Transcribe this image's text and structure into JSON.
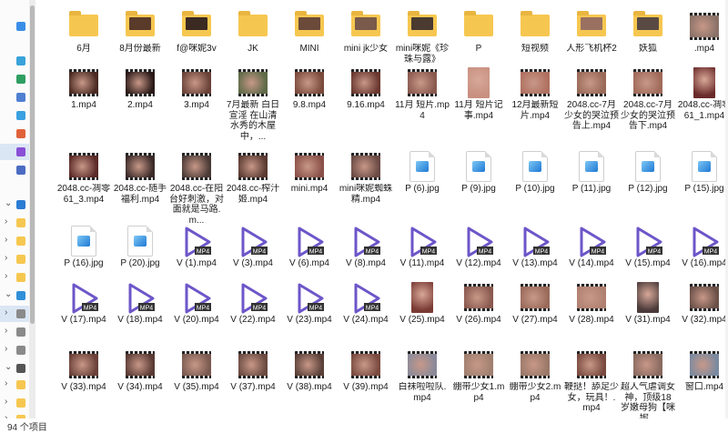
{
  "status": {
    "count": "94 个项目"
  },
  "colors": {
    "folder": "#f6c750",
    "play": "#6d56c9",
    "selection": "#dbe6f4"
  },
  "sidebar": [
    {
      "icon": "cloud-icon",
      "color": "#3a8ee6",
      "selected": false,
      "chevron": ""
    },
    {
      "icon": "desktop-icon",
      "color": "#39a2d8",
      "selected": false,
      "chevron": ""
    },
    {
      "icon": "downloads-icon",
      "color": "#2f9e62",
      "selected": false,
      "chevron": ""
    },
    {
      "icon": "documents-icon",
      "color": "#4f7fd1",
      "selected": false,
      "chevron": ""
    },
    {
      "icon": "pictures-icon",
      "color": "#3aa0e0",
      "selected": false,
      "chevron": ""
    },
    {
      "icon": "music-icon",
      "color": "#e0623a",
      "selected": false,
      "chevron": ""
    },
    {
      "icon": "videos-icon",
      "color": "#8a4fd6",
      "selected": true,
      "chevron": ""
    },
    {
      "icon": "drive-icon",
      "color": "#4b6cc2",
      "selected": false,
      "chevron": ""
    },
    {
      "icon": "onedrive-icon",
      "color": "#2b7cd3",
      "selected": false,
      "chevron": "⌄"
    },
    {
      "icon": "folder-icon",
      "color": "#f6c750",
      "selected": false,
      "chevron": "›"
    },
    {
      "icon": "folder-icon",
      "color": "#f6c750",
      "selected": false,
      "chevron": "›"
    },
    {
      "icon": "folder-icon",
      "color": "#f6c750",
      "selected": false,
      "chevron": "›"
    },
    {
      "icon": "folder-icon",
      "color": "#f6c750",
      "selected": false,
      "chevron": "›"
    },
    {
      "icon": "computer-icon",
      "color": "#2f8fd8",
      "selected": false,
      "chevron": "⌄"
    },
    {
      "icon": "drive-icon",
      "color": "#8a8a8a",
      "selected": true,
      "chevron": "›"
    },
    {
      "icon": "drive-icon",
      "color": "#8a8a8a",
      "selected": false,
      "chevron": "›"
    },
    {
      "icon": "drive-icon",
      "color": "#8a8a8a",
      "selected": false,
      "chevron": "›"
    },
    {
      "icon": "network-drive-icon",
      "color": "#555555",
      "selected": false,
      "chevron": "⌄"
    },
    {
      "icon": "folder-icon",
      "color": "#f6c750",
      "selected": false,
      "chevron": "›"
    },
    {
      "icon": "folder-icon",
      "color": "#f6c750",
      "selected": false,
      "chevron": "›"
    },
    {
      "icon": "folder-icon",
      "color": "#f6c750",
      "selected": false,
      "chevron": "›"
    }
  ],
  "files": [
    {
      "kind": "folder",
      "label": "6月"
    },
    {
      "kind": "folder-photo",
      "label": "8月份最新",
      "color": "#5a3b2a"
    },
    {
      "kind": "folder-photo",
      "label": "f@咪妮3v",
      "color": "#3a2a22"
    },
    {
      "kind": "folder",
      "label": "JK"
    },
    {
      "kind": "folder-photo",
      "label": "MINI",
      "color": "#6b4a3a"
    },
    {
      "kind": "folder-photo",
      "label": "mini jk少女",
      "color": "#7a5a4a"
    },
    {
      "kind": "folder-photo",
      "label": "mini咪妮《珍珠与露》",
      "color": "#4a3a30"
    },
    {
      "kind": "folder",
      "label": "P"
    },
    {
      "kind": "folder",
      "label": "短视频"
    },
    {
      "kind": "folder-photo",
      "label": "人形飞机杯2",
      "color": "#9a7060"
    },
    {
      "kind": "folder-photo",
      "label": "妖狐",
      "color": "#5a4a44"
    },
    {
      "kind": "video",
      "label": ".mp4",
      "color": "#8a7268"
    },
    {
      "kind": "video",
      "label": "1.mp4",
      "color": "#4a2a22"
    },
    {
      "kind": "video",
      "label": "2.mp4",
      "color": "#2a1a18"
    },
    {
      "kind": "video",
      "label": "3.mp4",
      "color": "#6a4238"
    },
    {
      "kind": "video",
      "label": "7月最新 白日宣淫 在山清水秀的木屋中，...",
      "color": "#5e6a48"
    },
    {
      "kind": "video",
      "label": "9.8.mp4",
      "color": "#7a4a3c"
    },
    {
      "kind": "video",
      "label": "9.16.mp4",
      "color": "#6a3830"
    },
    {
      "kind": "video",
      "label": "11月 短片.mp4",
      "color": "#8a5a50"
    },
    {
      "kind": "photo",
      "label": "11月 短片记事.mp4",
      "color": "#c89080"
    },
    {
      "kind": "video",
      "label": "12月最新短片.mp4",
      "color": "#b07060"
    },
    {
      "kind": "video",
      "label": "2048.cc-7月少女的哭泣预告上.mp4",
      "color": "#9a6a58"
    },
    {
      "kind": "video",
      "label": "2048.cc-7月少女的哭泣预告下.mp4",
      "color": "#a06a5a"
    },
    {
      "kind": "photo",
      "label": "2048.cc-凋零61_1.mp4",
      "color": "#6a2a2a"
    },
    {
      "kind": "video",
      "label": "2048.cc-凋零61_3.mp4",
      "color": "#5a2a28"
    },
    {
      "kind": "video",
      "label": "2048.cc-随手福利.mp4",
      "color": "#3a2a28"
    },
    {
      "kind": "video",
      "label": "2048.cc-在阳台好刺激，对面就是马路.m...",
      "color": "#4a3a36"
    },
    {
      "kind": "video",
      "label": "2048.cc-榨汁姬.mp4",
      "color": "#5a3a32"
    },
    {
      "kind": "video",
      "label": "mini.mp4",
      "color": "#8a5048"
    },
    {
      "kind": "video",
      "label": "mini咪妮蜘蛛精.mp4",
      "color": "#6a4a44"
    },
    {
      "kind": "image",
      "label": "P (6).jpg"
    },
    {
      "kind": "image",
      "label": "P (9).jpg"
    },
    {
      "kind": "image",
      "label": "P (10).jpg"
    },
    {
      "kind": "image",
      "label": "P (11).jpg"
    },
    {
      "kind": "image",
      "label": "P (12).jpg"
    },
    {
      "kind": "image",
      "label": "P (15).jpg"
    },
    {
      "kind": "image",
      "label": "P (16).jpg"
    },
    {
      "kind": "image",
      "label": "P (20).jpg"
    },
    {
      "kind": "mp4",
      "label": "V (1).mp4"
    },
    {
      "kind": "mp4",
      "label": "V (3).mp4"
    },
    {
      "kind": "mp4",
      "label": "V (6).mp4"
    },
    {
      "kind": "mp4",
      "label": "V (8).mp4"
    },
    {
      "kind": "mp4",
      "label": "V (11).mp4"
    },
    {
      "kind": "mp4",
      "label": "V (12).mp4"
    },
    {
      "kind": "mp4",
      "label": "V (13).mp4"
    },
    {
      "kind": "mp4",
      "label": "V (14).mp4"
    },
    {
      "kind": "mp4",
      "label": "V (15).mp4"
    },
    {
      "kind": "mp4",
      "label": "V (16).mp4"
    },
    {
      "kind": "mp4",
      "label": "V (17).mp4"
    },
    {
      "kind": "mp4",
      "label": "V (18).mp4"
    },
    {
      "kind": "mp4",
      "label": "V (20).mp4"
    },
    {
      "kind": "mp4",
      "label": "V (22).mp4"
    },
    {
      "kind": "mp4",
      "label": "V (23).mp4"
    },
    {
      "kind": "mp4",
      "label": "V (24).mp4"
    },
    {
      "kind": "photo",
      "label": "V (25).mp4",
      "color": "#7a3a34"
    },
    {
      "kind": "video",
      "label": "V (26).mp4",
      "color": "#8a5a50"
    },
    {
      "kind": "video",
      "label": "V (27).mp4",
      "color": "#9a6a5a"
    },
    {
      "kind": "video",
      "label": "V (28).mp4",
      "color": "#b08070"
    },
    {
      "kind": "photo",
      "label": "V (31).mp4",
      "color": "#4a3a3a"
    },
    {
      "kind": "video",
      "label": "V (32).mp4",
      "color": "#6a5048"
    },
    {
      "kind": "video",
      "label": "V (33).mp4",
      "color": "#6a4038"
    },
    {
      "kind": "video",
      "label": "V (34).mp4",
      "color": "#5a3a34"
    },
    {
      "kind": "video",
      "label": "V (35).mp4",
      "color": "#7a5a50"
    },
    {
      "kind": "video",
      "label": "V (37).mp4",
      "color": "#6a4a40"
    },
    {
      "kind": "video",
      "label": "V (38).mp4",
      "color": "#5a4038"
    },
    {
      "kind": "video",
      "label": "V (39).mp4",
      "color": "#7a4a40"
    },
    {
      "kind": "video",
      "label": "白袜啦啦队.mp4",
      "color": "#8a8a9a"
    },
    {
      "kind": "video",
      "label": "绷带少女1.mp4",
      "color": "#a08070"
    },
    {
      "kind": "video",
      "label": "绷带少女2.mp4",
      "color": "#9a7868"
    },
    {
      "kind": "video",
      "label": "鞭挞！舔足少女，玩具！.mp4",
      "color": "#7a4a40"
    },
    {
      "kind": "video",
      "label": "超人气虐调女神，顶级18岁嫩母狗【咪妮...",
      "color": "#8a6a60"
    },
    {
      "kind": "video",
      "label": "窗口.mp4",
      "color": "#7a8aa0"
    }
  ]
}
